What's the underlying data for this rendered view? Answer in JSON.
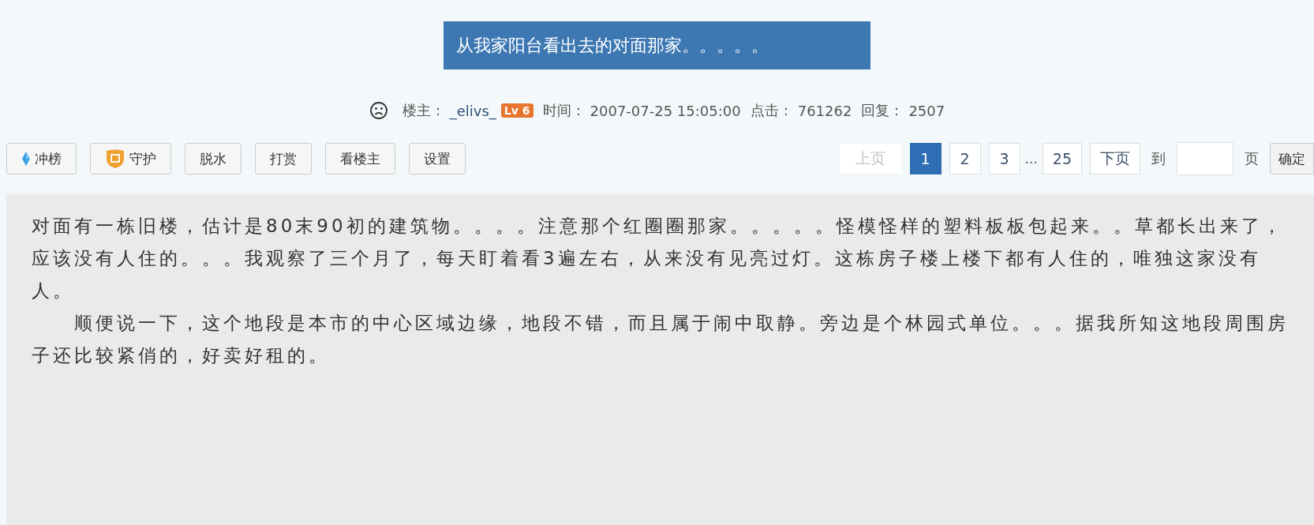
{
  "post": {
    "title": "从我家阳台看出去的对面那家。。。。。"
  },
  "meta": {
    "author_label": "楼主：",
    "author": "_elivs_",
    "level_badge": "Lv 6",
    "time_label": "时间：",
    "time": "2007-07-25 15:05:00",
    "clicks_label": "点击：",
    "clicks": "761262",
    "replies_label": "回复：",
    "replies": "2507"
  },
  "toolbar": [
    {
      "kind": "diamond",
      "label": "冲榜"
    },
    {
      "kind": "shield",
      "label": "守护"
    },
    {
      "kind": "plain",
      "label": "脱水"
    },
    {
      "kind": "plain",
      "label": "打赏"
    },
    {
      "kind": "plain",
      "label": "看楼主"
    },
    {
      "kind": "plain",
      "label": "设置"
    }
  ],
  "pagination": {
    "items": [
      {
        "kind": "prev",
        "label": "上页",
        "disabled": true,
        "selected": false
      },
      {
        "kind": "page",
        "label": "1",
        "disabled": false,
        "selected": true
      },
      {
        "kind": "page",
        "label": "2",
        "disabled": false,
        "selected": false
      },
      {
        "kind": "page",
        "label": "3",
        "disabled": false,
        "selected": false
      },
      {
        "kind": "ellipsis",
        "label": "..."
      },
      {
        "kind": "page",
        "label": "25",
        "disabled": false,
        "selected": false
      },
      {
        "kind": "next",
        "label": "下页",
        "disabled": false,
        "selected": false
      }
    ],
    "goto_label": "到",
    "page_unit": "页",
    "confirm": "确定"
  },
  "body": {
    "paragraphs": [
      "对面有一栋旧楼，估计是80末90初的建筑物。。。。注意那个红圈圈那家。。。。。怪模怪样的塑料板板包起来。。草都长出来了，应该没有人住的。。。我观察了三个月了，每天盯着看3遍左右，从来没有见亮过灯。这栋房子楼上楼下都有人住的，唯独这家没有人。",
      "　　顺便说一下，这个地段是本市的中心区域边缘，地段不错，而且属于闹中取静。旁边是个林园式单位。。。据我所知这地段周围房子还比较紧俏的，好卖好租的。"
    ]
  }
}
